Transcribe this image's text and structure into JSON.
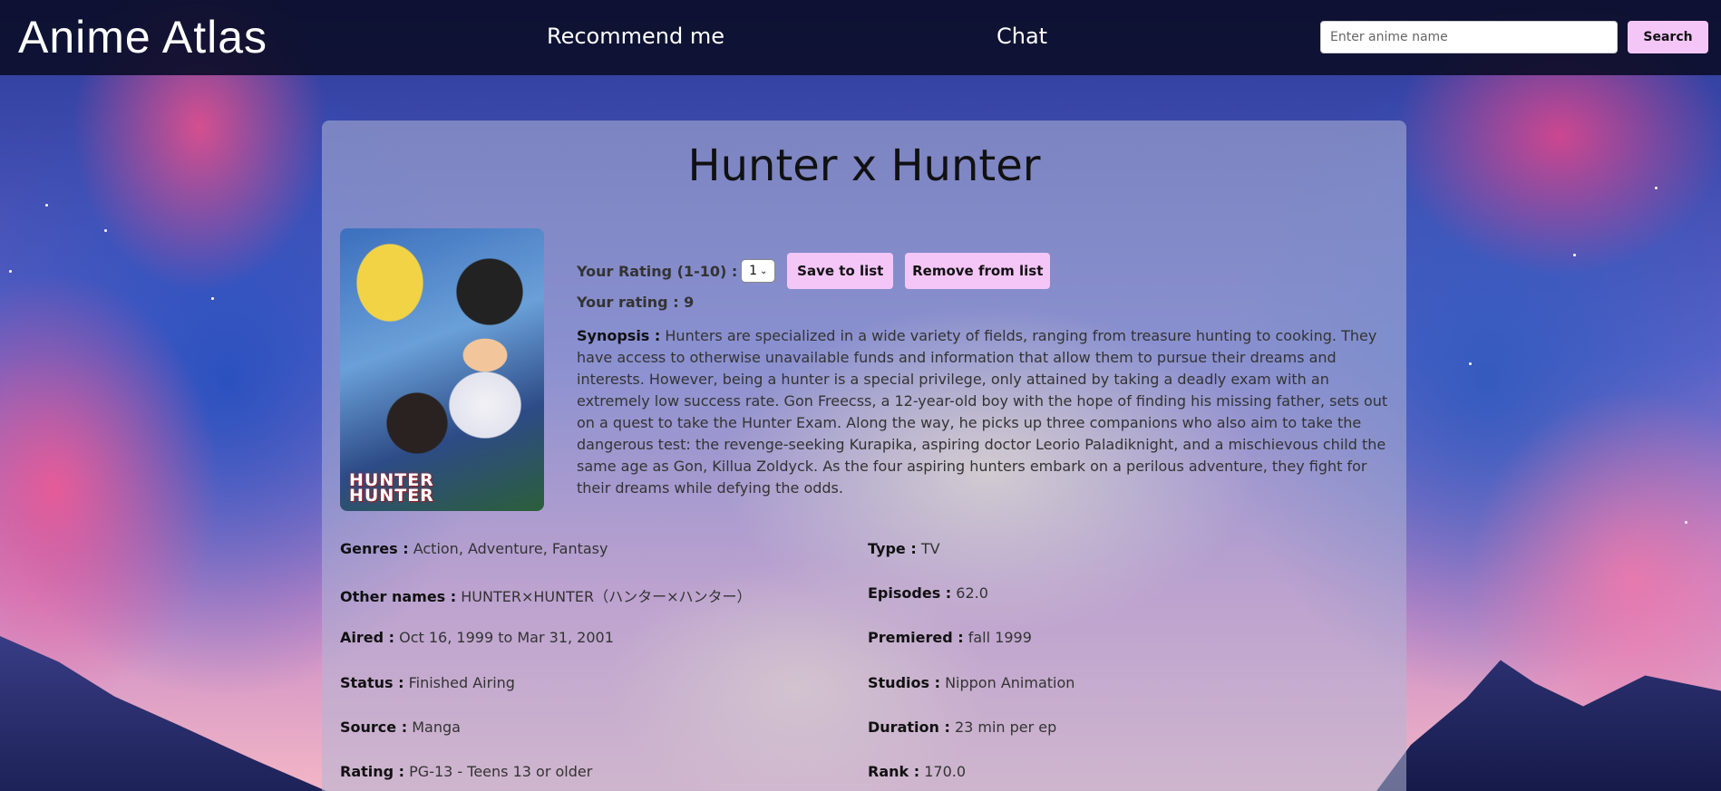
{
  "navbar": {
    "brand": "Anime Atlas",
    "links": [
      {
        "label": "Recommend me"
      },
      {
        "label": "Chat"
      }
    ],
    "search": {
      "placeholder": "Enter anime name",
      "value": "",
      "button_label": "Search"
    }
  },
  "anime": {
    "title": "Hunter x Hunter",
    "poster_logo": "HUNTER\nHUNTER",
    "rating_label": "Your Rating (1-10) :",
    "rating_select_value": "1",
    "save_label": "Save to list",
    "remove_label": "Remove from list",
    "your_rating_label": "Your rating :",
    "your_rating_value": "9",
    "synopsis_label": "Synopsis :",
    "synopsis": "Hunters are specialized in a wide variety of fields, ranging from treasure hunting to cooking. They have access to otherwise unavailable funds and information that allow them to pursue their dreams and interests. However, being a hunter is a special privilege, only attained by taking a deadly exam with an extremely low success rate. Gon Freecss, a 12-year-old boy with the hope of finding his missing father, sets out on a quest to take the Hunter Exam. Along the way, he picks up three companions who also aim to take the dangerous test: the revenge-seeking Kurapika, aspiring doctor Leorio Paladiknight, and a mischievous child the same age as Gon, Killua Zoldyck. As the four aspiring hunters embark on a perilous adventure, they fight for their dreams while defying the odds.",
    "info_left": [
      {
        "label": "Genres :",
        "value": "Action, Adventure, Fantasy"
      },
      {
        "label": "Other names :",
        "value": "HUNTER×HUNTER（ハンター×ハンター）"
      },
      {
        "label": "Aired :",
        "value": "Oct 16, 1999 to Mar 31, 2001"
      },
      {
        "label": "Status :",
        "value": "Finished Airing"
      },
      {
        "label": "Source :",
        "value": "Manga"
      },
      {
        "label": "Rating :",
        "value": "PG-13 - Teens 13 or older"
      }
    ],
    "info_right": [
      {
        "label": "Type :",
        "value": "TV"
      },
      {
        "label": "Episodes :",
        "value": "62.0"
      },
      {
        "label": "Premiered :",
        "value": "fall 1999"
      },
      {
        "label": "Studios :",
        "value": "Nippon Animation"
      },
      {
        "label": "Duration :",
        "value": "23 min per ep"
      },
      {
        "label": "Rank :",
        "value": "170.0"
      }
    ]
  }
}
